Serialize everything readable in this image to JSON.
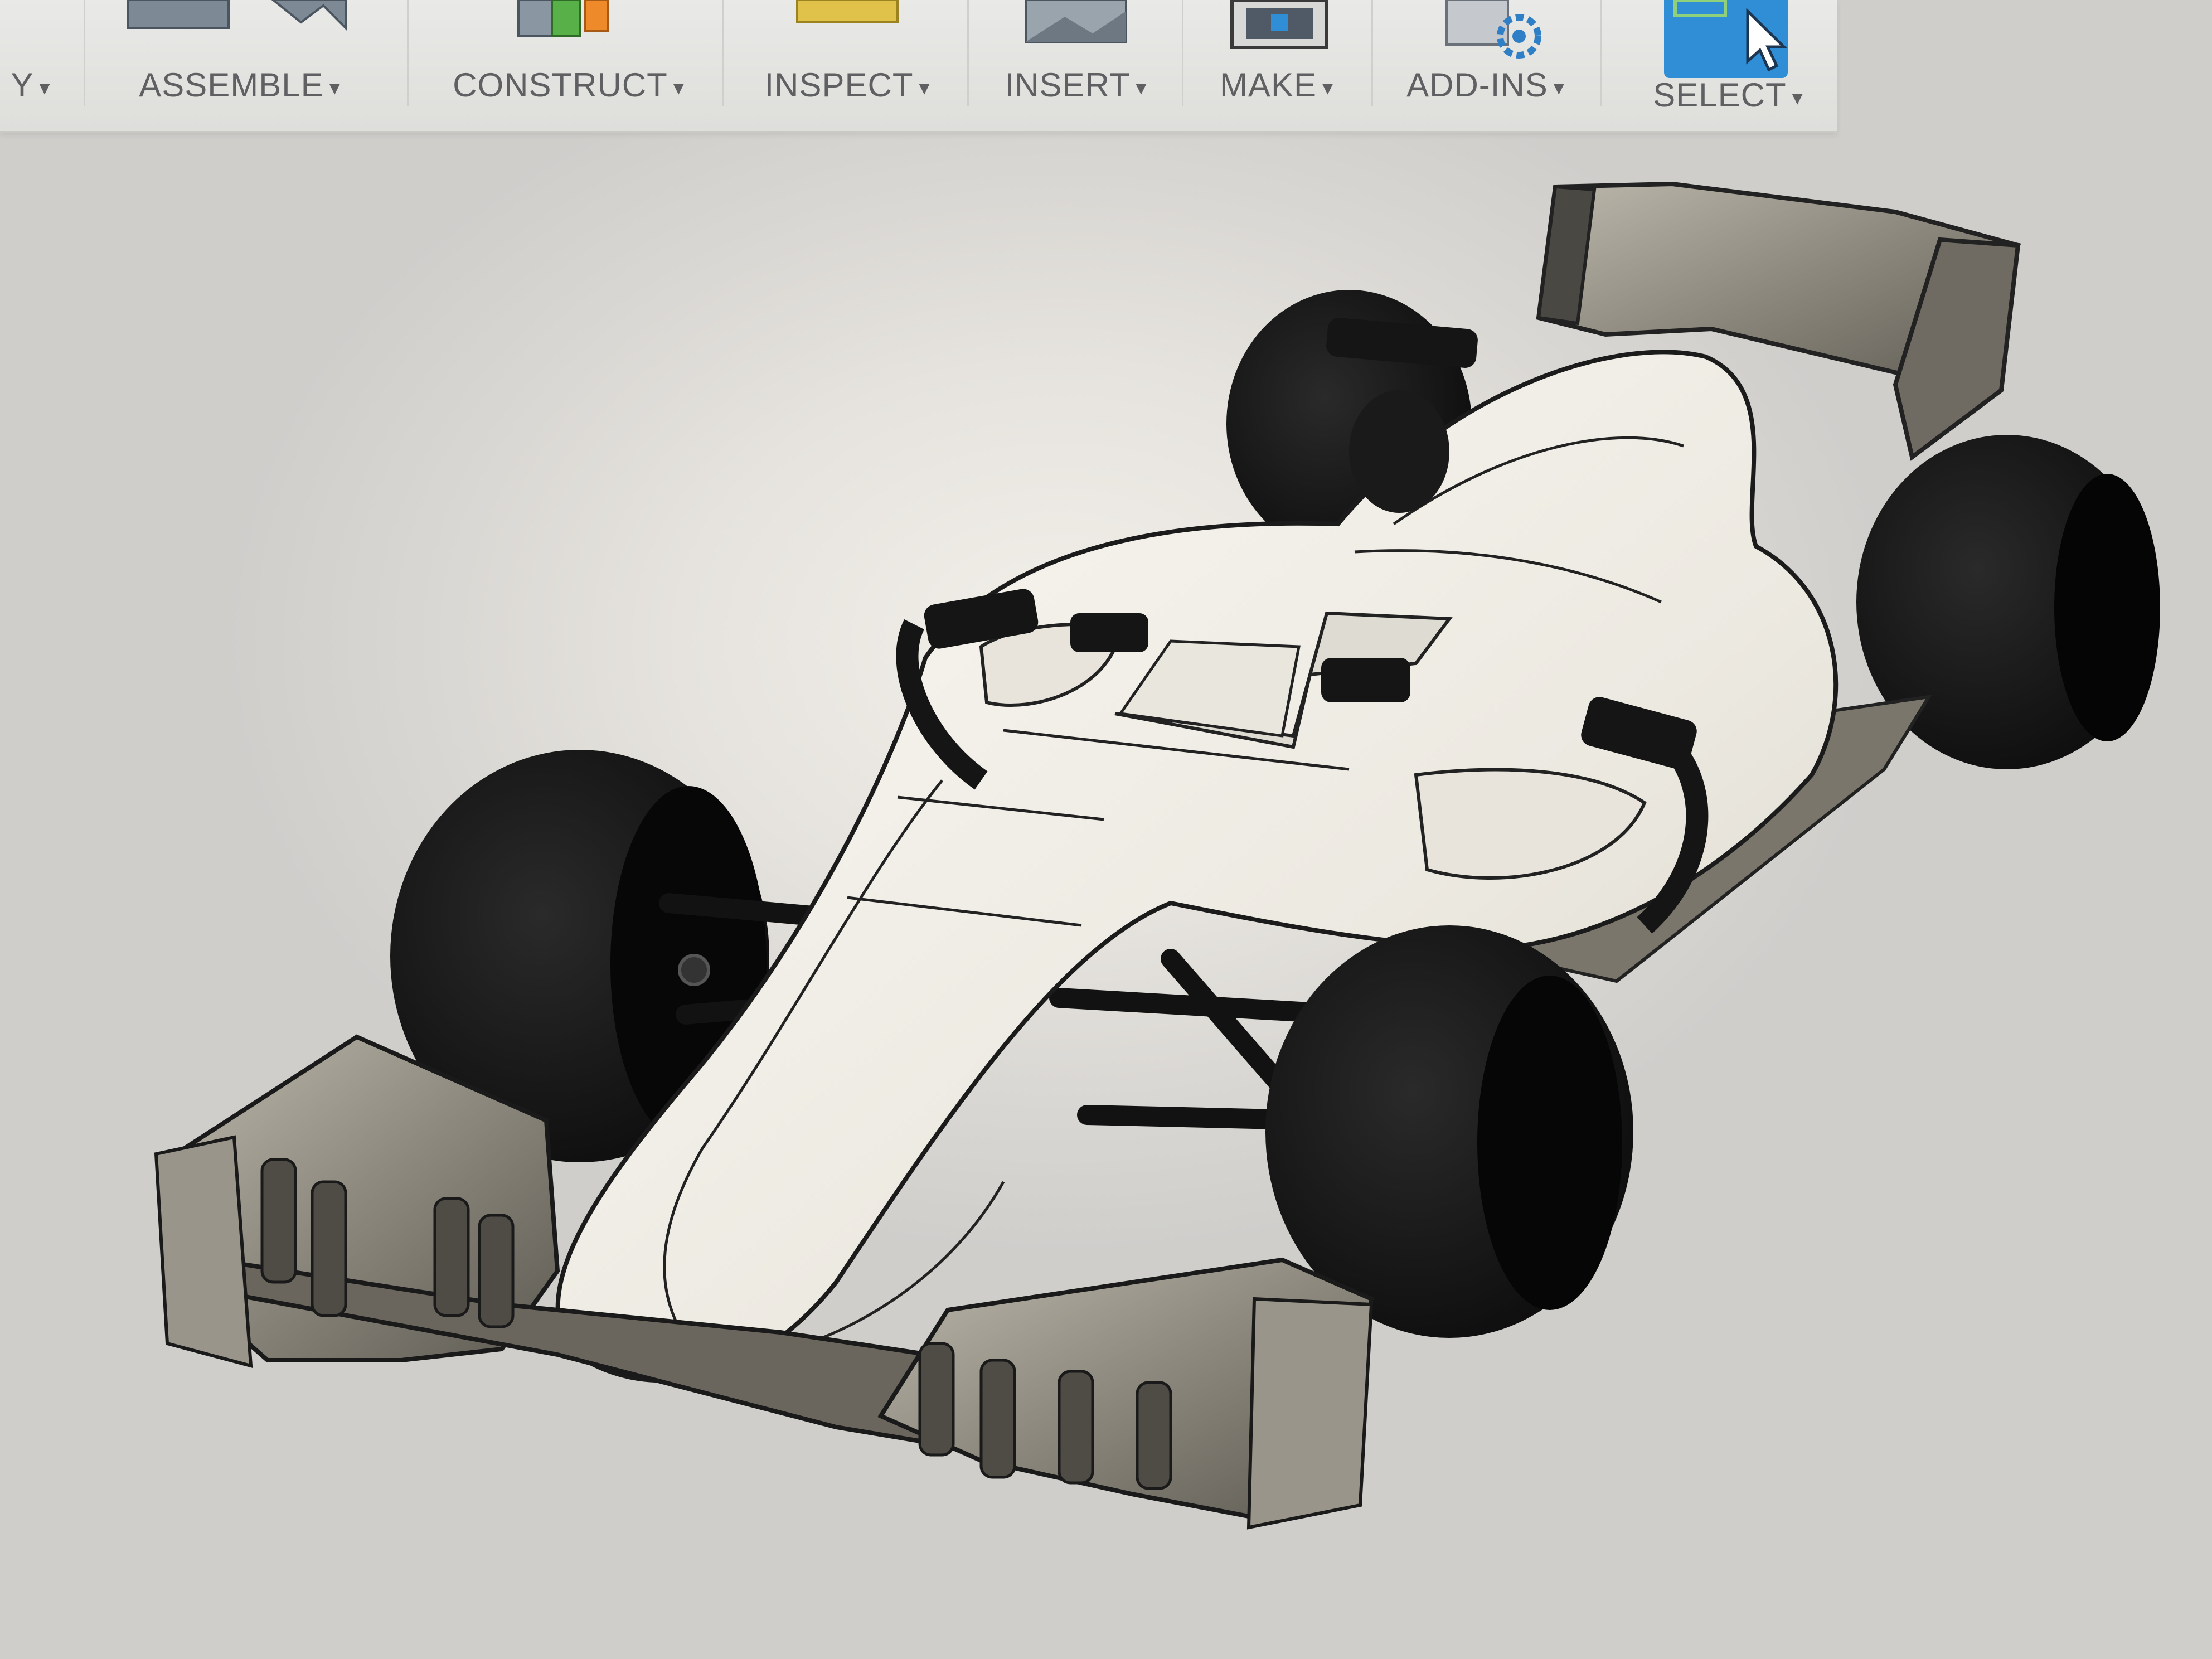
{
  "toolbar": {
    "groups": [
      {
        "label": "Y"
      },
      {
        "label": "ASSEMBLE"
      },
      {
        "label": "CONSTRUCT"
      },
      {
        "label": "INSPECT"
      },
      {
        "label": "INSERT"
      },
      {
        "label": "MAKE"
      },
      {
        "label": "ADD-INS"
      },
      {
        "label": "SELECT"
      }
    ],
    "caret": "▾"
  },
  "colors": {
    "toolbar_bg": "#e3e3e0",
    "select_accent": "#2f8ed6",
    "body_white": "#f0eee8",
    "tyre_black": "#141414",
    "wing_grey": "#8a867c"
  }
}
